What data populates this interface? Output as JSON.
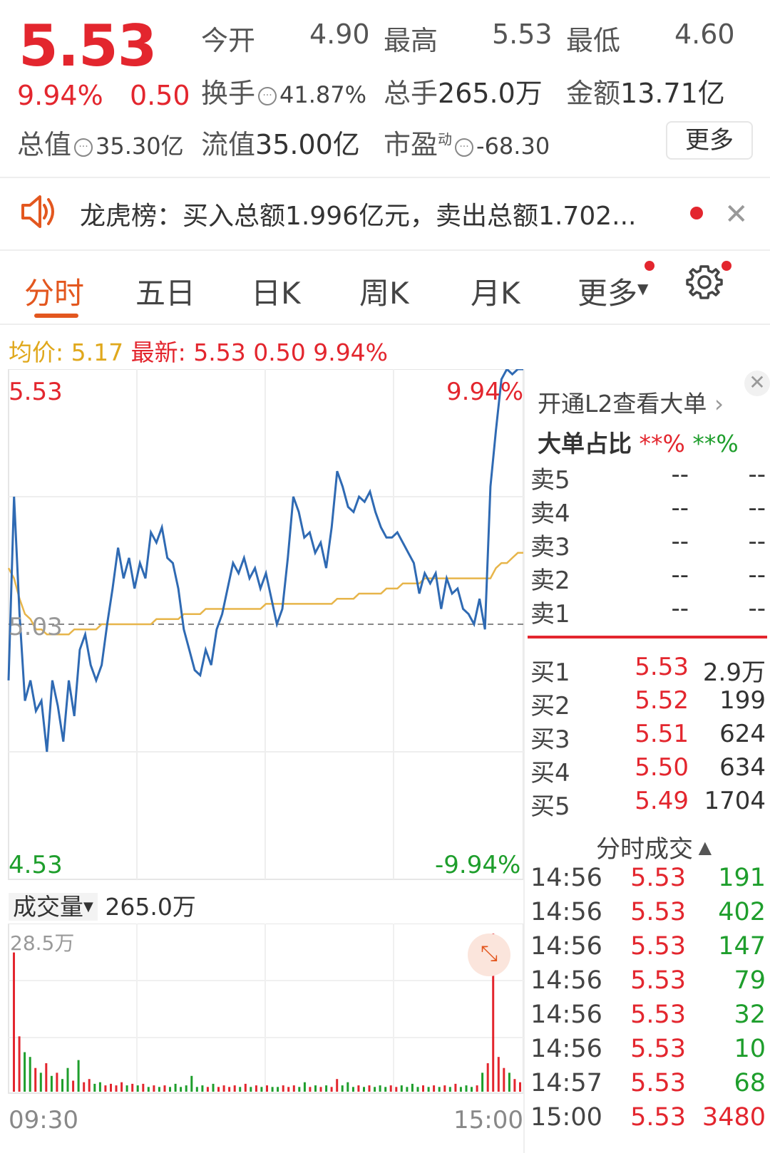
{
  "quote": {
    "price": "5.53",
    "change_pct": "9.94%",
    "change": "0.50",
    "open_label": "今开",
    "open": "4.90",
    "high_label": "最高",
    "high": "5.53",
    "low_label": "最低",
    "low": "4.60",
    "turnover_label": "换手",
    "turnover": "41.87%",
    "volume_label": "总手",
    "volume": "265.0万",
    "amount_label": "金额",
    "amount": "13.71亿",
    "mktcap_label": "总值",
    "mktcap": "35.30亿",
    "float_label": "流值",
    "float": "35.00亿",
    "pe_label": "市盈",
    "pe_sup": "动",
    "pe": "-68.30",
    "more_label": "更多"
  },
  "notice": {
    "text": "龙虎榜：买入总额1.996亿元，卖出总额1.702...",
    "speaker_icon": "speaker-icon",
    "close_icon": "close-icon"
  },
  "tabs": [
    {
      "label": "分时",
      "active": true
    },
    {
      "label": "五日"
    },
    {
      "label": "日K"
    },
    {
      "label": "周K"
    },
    {
      "label": "月K"
    },
    {
      "label": "更多"
    }
  ],
  "avg_row": {
    "avg_label": "均价:",
    "avg": "5.17",
    "latest_label": "最新:",
    "latest": "5.53",
    "chg": "0.50",
    "pct": "9.94%"
  },
  "chart_data": {
    "type": "line",
    "y_top": "5.53",
    "y_mid": "5.03",
    "y_bottom": "4.53",
    "pct_top": "9.94%",
    "pct_bottom": "-9.94%",
    "ylim": [
      4.53,
      5.53
    ],
    "x_start": "09:30",
    "x_end": "15:00",
    "series": [
      {
        "values": [
          4.92,
          5.28,
          5.05,
          4.88,
          4.92,
          4.86,
          4.88,
          4.78,
          4.92,
          4.87,
          4.8,
          4.92,
          4.85,
          4.98,
          5.01,
          4.95,
          4.92,
          4.95,
          5.03,
          5.1,
          5.18,
          5.12,
          5.16,
          5.1,
          5.15,
          5.12,
          5.21,
          5.19,
          5.22,
          5.16,
          5.15,
          5.1,
          5.02,
          4.98,
          4.94,
          4.93,
          4.98,
          4.95,
          5.02,
          5.05,
          5.1,
          5.15,
          5.13,
          5.16,
          5.12,
          5.14,
          5.1,
          5.13,
          5.08,
          5.03,
          5.06,
          5.16,
          5.28,
          5.25,
          5.2,
          5.21,
          5.17,
          5.19,
          5.14,
          5.22,
          5.33,
          5.3,
          5.26,
          5.25,
          5.28,
          5.27,
          5.29,
          5.25,
          5.22,
          5.2,
          5.2,
          5.21,
          5.19,
          5.17,
          5.15,
          5.09,
          5.13,
          5.11,
          5.13,
          5.06,
          5.12,
          5.09,
          5.1,
          5.06,
          5.05,
          5.03,
          5.08,
          5.02,
          5.3,
          5.41,
          5.51,
          5.53,
          5.52,
          5.53,
          5.53
        ]
      },
      {
        "values": [
          5.14,
          5.12,
          5.08,
          5.05,
          5.04,
          5.02,
          5.02,
          5.01,
          5.01,
          5.01,
          5.01,
          5.01,
          5.02,
          5.02,
          5.02,
          5.02,
          5.02,
          5.03,
          5.03,
          5.03,
          5.03,
          5.03,
          5.03,
          5.03,
          5.03,
          5.03,
          5.03,
          5.04,
          5.04,
          5.04,
          5.04,
          5.04,
          5.05,
          5.05,
          5.05,
          5.05,
          5.06,
          5.06,
          5.06,
          5.06,
          5.06,
          5.06,
          5.06,
          5.06,
          5.06,
          5.06,
          5.06,
          5.07,
          5.07,
          5.07,
          5.07,
          5.07,
          5.07,
          5.07,
          5.07,
          5.07,
          5.07,
          5.07,
          5.07,
          5.07,
          5.08,
          5.08,
          5.08,
          5.08,
          5.09,
          5.09,
          5.09,
          5.09,
          5.09,
          5.1,
          5.1,
          5.1,
          5.11,
          5.11,
          5.11,
          5.11,
          5.12,
          5.12,
          5.12,
          5.12,
          5.12,
          5.12,
          5.12,
          5.12,
          5.12,
          5.12,
          5.12,
          5.12,
          5.12,
          5.14,
          5.15,
          5.15,
          5.16,
          5.17,
          5.17
        ]
      }
    ]
  },
  "volume": {
    "label": "成交量",
    "total": "265.0万",
    "max_label": "28.5万",
    "bars": [
      0.88,
      0.35,
      0.25,
      0.22,
      0.15,
      0.12,
      0.18,
      0.1,
      0.12,
      0.08,
      0.15,
      0.07,
      0.2,
      0.06,
      0.08,
      0.05,
      0.06,
      0.04,
      0.05,
      0.04,
      0.06,
      0.04,
      0.05,
      0.04,
      0.05,
      0.03,
      0.04,
      0.03,
      0.04,
      0.03,
      0.05,
      0.03,
      0.04,
      0.1,
      0.03,
      0.04,
      0.03,
      0.05,
      0.03,
      0.04,
      0.03,
      0.04,
      0.03,
      0.05,
      0.03,
      0.04,
      0.03,
      0.04,
      0.03,
      0.03,
      0.04,
      0.03,
      0.04,
      0.03,
      0.06,
      0.03,
      0.04,
      0.03,
      0.04,
      0.03,
      0.08,
      0.04,
      0.06,
      0.03,
      0.04,
      0.03,
      0.04,
      0.03,
      0.04,
      0.03,
      0.04,
      0.03,
      0.04,
      0.03,
      0.05,
      0.03,
      0.04,
      0.03,
      0.04,
      0.03,
      0.04,
      0.03,
      0.05,
      0.03,
      0.04,
      0.03,
      0.04,
      0.12,
      0.18,
      1.0,
      0.22,
      0.15,
      0.12,
      0.08,
      0.06
    ]
  },
  "panel": {
    "l2_text": "开通L2查看大单",
    "ratio_label": "大单占比",
    "ratio_red": "**%",
    "ratio_green": "**%",
    "sells": [
      {
        "name": "卖5",
        "price": "--",
        "qty": "--"
      },
      {
        "name": "卖4",
        "price": "--",
        "qty": "--"
      },
      {
        "name": "卖3",
        "price": "--",
        "qty": "--"
      },
      {
        "name": "卖2",
        "price": "--",
        "qty": "--"
      },
      {
        "name": "卖1",
        "price": "--",
        "qty": "--"
      }
    ],
    "buys": [
      {
        "name": "买1",
        "price": "5.53",
        "qty": "2.9万"
      },
      {
        "name": "买2",
        "price": "5.52",
        "qty": "199"
      },
      {
        "name": "买3",
        "price": "5.51",
        "qty": "624"
      },
      {
        "name": "买4",
        "price": "5.50",
        "qty": "634"
      },
      {
        "name": "买5",
        "price": "5.49",
        "qty": "1704"
      }
    ],
    "trade_title": "分时成交",
    "trades": [
      {
        "time": "14:56",
        "price": "5.53",
        "qty": "191"
      },
      {
        "time": "14:56",
        "price": "5.53",
        "qty": "402"
      },
      {
        "time": "14:56",
        "price": "5.53",
        "qty": "147"
      },
      {
        "time": "14:56",
        "price": "5.53",
        "qty": "79"
      },
      {
        "time": "14:56",
        "price": "5.53",
        "qty": "32"
      },
      {
        "time": "14:56",
        "price": "5.53",
        "qty": "10"
      },
      {
        "time": "14:57",
        "price": "5.53",
        "qty": "68"
      },
      {
        "time": "15:00",
        "price": "5.53",
        "qty": "3480"
      }
    ]
  },
  "colors": {
    "red": "#e3262e",
    "green": "#1e9e2c",
    "orange": "#e3571f",
    "price_line": "#2f6ab3",
    "avg_line": "#e7b54a"
  }
}
